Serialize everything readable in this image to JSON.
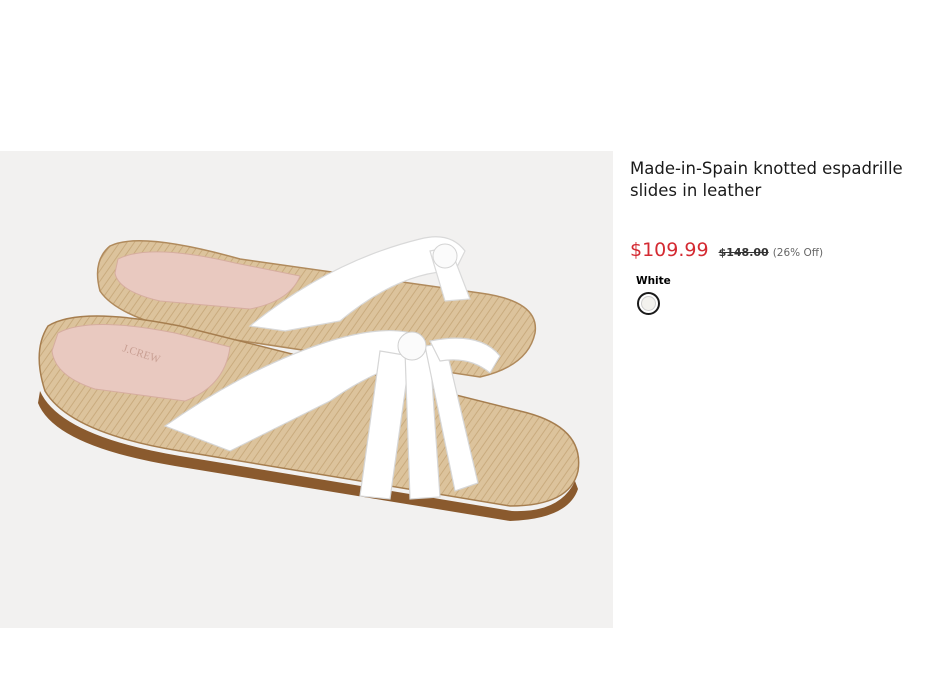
{
  "product": {
    "image_alt": "J.Crew knotted espadrille slides in white leather",
    "image_logo_text": "J.CREW",
    "title": "Made-in-Spain knotted espadrille slides in leather",
    "sale_price": "$109.99",
    "original_price": "$148.00",
    "discount": "(26% Off)",
    "color_label": "White",
    "swatches": [
      {
        "name": "White",
        "color": "#f3f2ee",
        "selected": true
      }
    ]
  },
  "colors": {
    "sale_price": "#d42a32",
    "image_background": "#f2f1f0"
  }
}
